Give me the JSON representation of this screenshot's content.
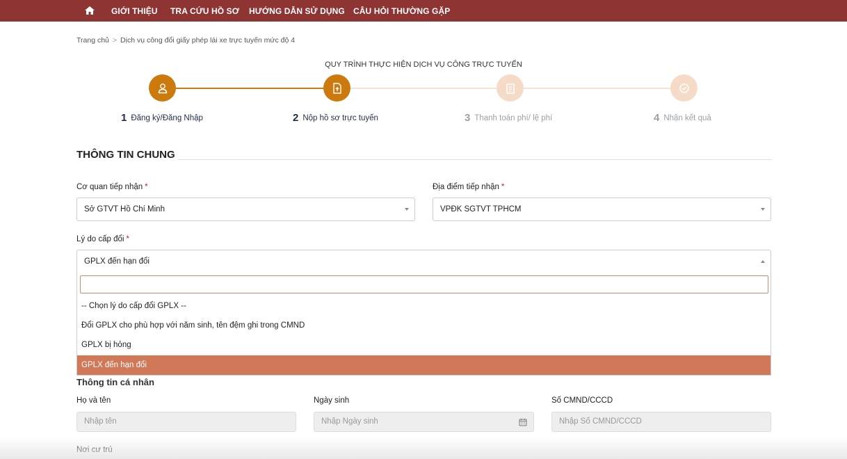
{
  "nav": {
    "items": [
      {
        "label": "GIỚI THIỆU"
      },
      {
        "label": "TRA CỨU HỒ SƠ"
      },
      {
        "label": "HƯỚNG DẪN SỬ DỤNG"
      },
      {
        "label": "CÂU HỎI THƯỜNG GẶP"
      }
    ]
  },
  "breadcrumb": {
    "home": "Trang chủ",
    "separator": ">",
    "current": "Dịch vụ công đổi giấy phép lái xe trực tuyến mức độ 4"
  },
  "process": {
    "title": "QUY TRÌNH THỰC HIỆN DỊCH VỤ CÔNG TRỰC TUYẾN",
    "steps": [
      {
        "num": "1",
        "label": "Đăng ký/Đăng Nhập",
        "icon": "user-icon",
        "state": "done"
      },
      {
        "num": "2",
        "label": "Nộp hồ sơ trực tuyến",
        "icon": "document-upload-icon",
        "state": "active"
      },
      {
        "num": "3",
        "label": "Thanh toán phí/ lệ phí",
        "icon": "clipboard-icon",
        "state": "pending"
      },
      {
        "num": "4",
        "label": "Nhận kết quả",
        "icon": "check-circle-icon",
        "state": "pending"
      }
    ]
  },
  "general": {
    "title": "THÔNG TIN CHUNG",
    "agency": {
      "label": "Cơ quan tiếp nhận",
      "required": "*",
      "value": "Sở GTVT Hồ Chí Minh"
    },
    "location": {
      "label": "Địa điểm tiếp nhận",
      "required": "*",
      "value": "VPĐK SGTVT TPHCM"
    },
    "reason": {
      "label": "Lý do cấp đổi",
      "required": "*",
      "value": "GPLX đến hạn đổi",
      "search_value": "",
      "options": [
        "-- Chọn lý do cấp đổi GPLX --",
        "Đổi GPLX cho phù hợp với năm sinh, tên đệm ghi trong CMND",
        "GPLX bị hỏng",
        "GPLX đến hạn đổi"
      ],
      "selected_index": 3
    }
  },
  "personal": {
    "title": "Thông tin cá nhân",
    "name": {
      "label": "Họ và tên",
      "placeholder": "Nhập tên"
    },
    "dob": {
      "label": "Ngày sinh",
      "placeholder": "Nhập Ngày sinh"
    },
    "id_number": {
      "label": "Số CMND/CCCD",
      "placeholder": "Nhập Số CMND/CCCD"
    },
    "residence": {
      "label": "Nơi cư trú"
    }
  },
  "colors": {
    "nav_bg": "#8e3433",
    "step_active": "#cc7a0e",
    "step_pending": "#f6dcc8",
    "step_pending_text": "#9aa0a8",
    "option_selected": "#d07858",
    "required": "#c0272d"
  }
}
